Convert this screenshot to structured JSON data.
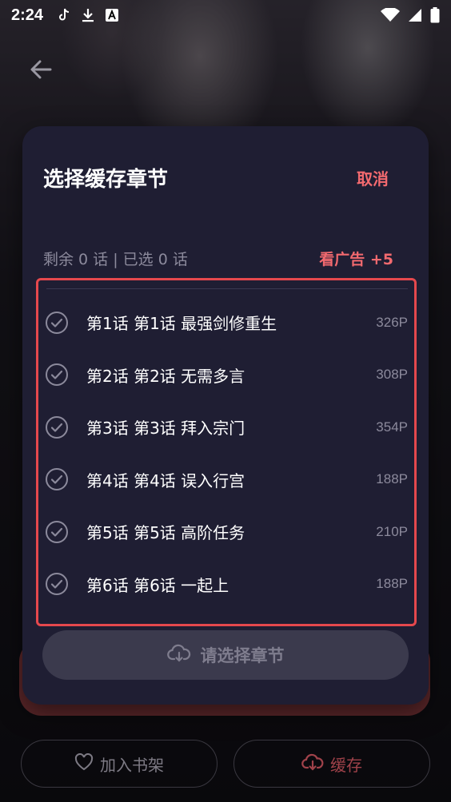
{
  "status_bar": {
    "time": "2:24"
  },
  "sheet": {
    "title": "选择缓存章节",
    "cancel_label": "取消",
    "stats": "剩余 0 话 | 已选 0 话",
    "ad_label": "看广告 +5",
    "chapters": [
      {
        "title": "第1话 第1话 最强剑修重生",
        "pages": "326P"
      },
      {
        "title": "第2话 第2话 无需多言",
        "pages": "308P"
      },
      {
        "title": "第3话 第3话 拜入宗门",
        "pages": "354P"
      },
      {
        "title": "第4话 第4话 误入行宫",
        "pages": "188P"
      },
      {
        "title": "第5话 第5话 高阶任务",
        "pages": "210P"
      },
      {
        "title": "第6话 第6话 一起上",
        "pages": "188P"
      }
    ],
    "download_label": "请选择章节"
  },
  "bottom_bar": {
    "shelf_label": "加入书架",
    "cache_label": "缓存"
  },
  "colors": {
    "accent": "#f36a6f",
    "sheet_bg": "#1f1e33",
    "highlight_border": "#e5484d"
  }
}
